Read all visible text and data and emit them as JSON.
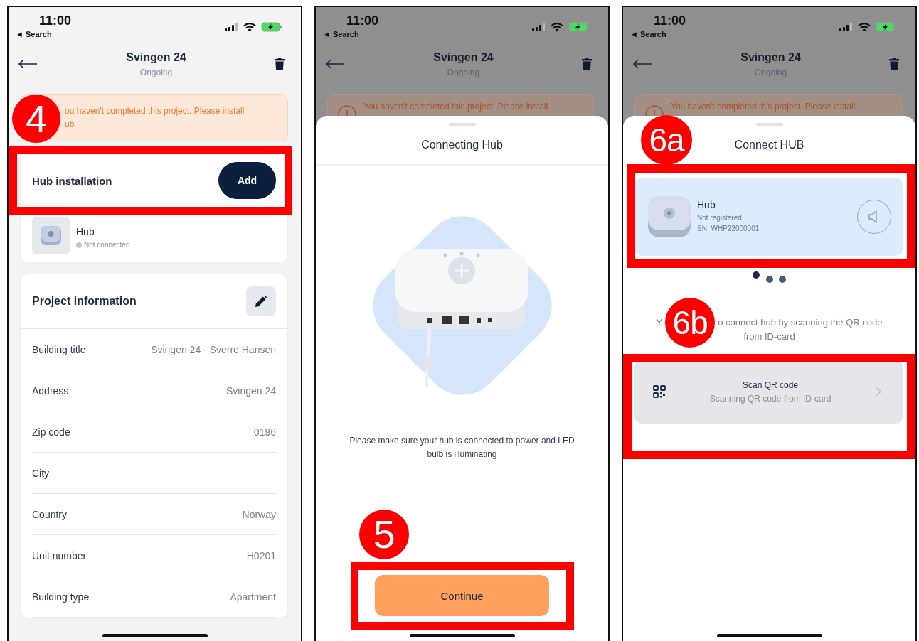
{
  "screens": [
    {
      "kind": "project",
      "dimmed": false,
      "status_bar": {
        "time": "11:00",
        "back_app": "◄ Search"
      },
      "header": {
        "title": "Svingen 24",
        "subtitle": "Ongoing"
      },
      "banner": {
        "lines": [
          "ou haven't completed this project. Please install",
          "ub"
        ]
      },
      "hub_installation": {
        "title": "Hub installation",
        "button": "Add",
        "device": {
          "name": "Hub",
          "status": "Not connected",
          "connected": false
        }
      },
      "project_information": {
        "title": "Project information",
        "rows": [
          {
            "label": "Building title",
            "value": "Svingen 24 - Sverre Hansen"
          },
          {
            "label": "Address",
            "value": "Svingen 24"
          },
          {
            "label": "Zip code",
            "value": "0196"
          },
          {
            "label": "City"
          },
          {
            "label": "Country",
            "value": "Norway"
          },
          {
            "label": "Unit number",
            "value": "H0201"
          },
          {
            "label": "Building type",
            "value": "Apartment"
          }
        ]
      },
      "annotations": {
        "badges": [
          "4"
        ]
      }
    },
    {
      "kind": "connecting",
      "dimmed": true,
      "status_bar": {
        "time": "11:00",
        "back_app": "◄ Search"
      },
      "header": {
        "title": "Svingen 24",
        "subtitle": "Ongoing"
      },
      "banner": {
        "lines": [
          "You haven't completed this project. Please install"
        ]
      },
      "sheet": {
        "title": "Connecting Hub",
        "instruction": "Please make sure your hub is connected to power and LED bulb is illuminating",
        "button": "Continue"
      },
      "annotations": {
        "badges": [
          "5"
        ]
      }
    },
    {
      "kind": "connect",
      "dimmed": true,
      "status_bar": {
        "time": "11:00",
        "back_app": "◄ Search"
      },
      "header": {
        "title": "Svingen 24",
        "subtitle": "Ongoing"
      },
      "banner": {
        "lines": [
          "You haven't completed this project. Please install"
        ]
      },
      "sheet": {
        "title": "Connect HUB",
        "device": {
          "name": "Hub",
          "status": "Not registered",
          "serial": "SN: WHP22000001"
        },
        "hint_parts": [
          "Y",
          "o connect hub by scanning the QR code",
          "from ID-card"
        ],
        "scan_option": {
          "title": "Scan QR code",
          "subtitle": "Scanning QR code from ID-card"
        }
      },
      "annotations": {
        "badges": [
          "6a",
          "6b"
        ]
      }
    }
  ]
}
